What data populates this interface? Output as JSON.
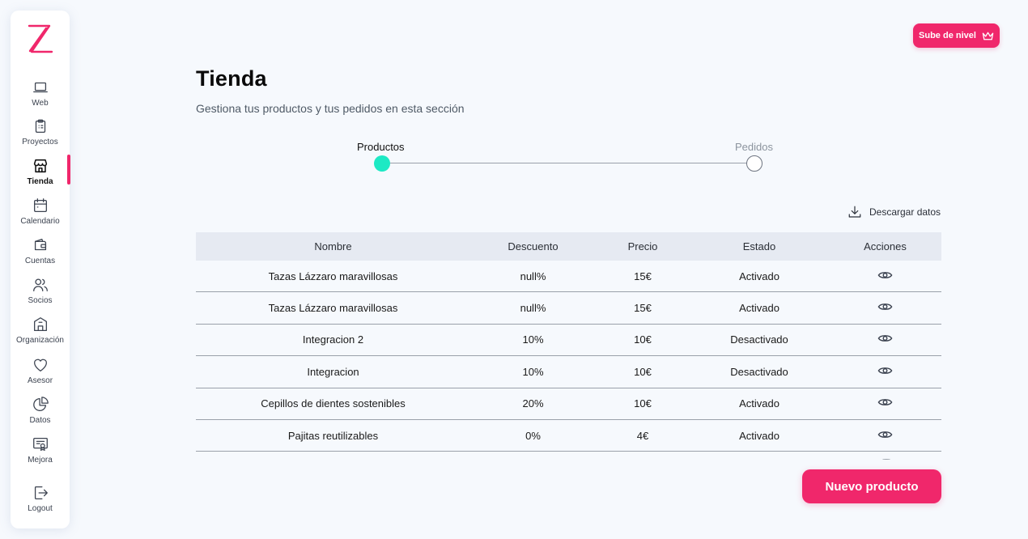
{
  "sidebar": {
    "items": [
      {
        "label": "Web",
        "icon": "laptop-icon"
      },
      {
        "label": "Proyectos",
        "icon": "clipboard-icon"
      },
      {
        "label": "Tienda",
        "icon": "store-icon"
      },
      {
        "label": "Calendario",
        "icon": "calendar-icon"
      },
      {
        "label": "Cuentas",
        "icon": "wallet-icon"
      },
      {
        "label": "Socios",
        "icon": "users-icon"
      },
      {
        "label": "Organización",
        "icon": "building-icon"
      },
      {
        "label": "Asesor",
        "icon": "heart-icon"
      },
      {
        "label": "Datos",
        "icon": "pie-chart-icon"
      },
      {
        "label": "Mejora",
        "icon": "certificate-icon"
      },
      {
        "label": "Logout",
        "icon": "logout-icon"
      }
    ],
    "active": "Tienda"
  },
  "header": {
    "upgrade_label": "Sube de nivel",
    "title": "Tienda",
    "subtitle": "Gestiona tus productos y tus pedidos en esta sección"
  },
  "stepper": {
    "steps": [
      "Productos",
      "Pedidos"
    ],
    "active_index": 0
  },
  "download_label": "Descargar datos",
  "table": {
    "columns": [
      "Nombre",
      "Descuento",
      "Precio",
      "Estado",
      "Acciones"
    ],
    "rows": [
      [
        "Tazas Lázzaro maravillosas",
        "null%",
        "15€",
        "Activado"
      ],
      [
        "Tazas Lázzaro maravillosas",
        "null%",
        "15€",
        "Activado"
      ],
      [
        "Integracion 2",
        "10%",
        "10€",
        "Desactivado"
      ],
      [
        "Integracion",
        "10%",
        "10€",
        "Desactivado"
      ],
      [
        "Cepillos de dientes sostenibles",
        "20%",
        "10€",
        "Activado"
      ],
      [
        "Pajitas reutilizables",
        "0%",
        "4€",
        "Activado"
      ]
    ]
  },
  "new_product_label": "Nuevo producto",
  "colors": {
    "accent": "#f0276b",
    "step_active": "#1de9c4",
    "background": "#f6f9fd",
    "table_header": "#e6eaf2"
  }
}
